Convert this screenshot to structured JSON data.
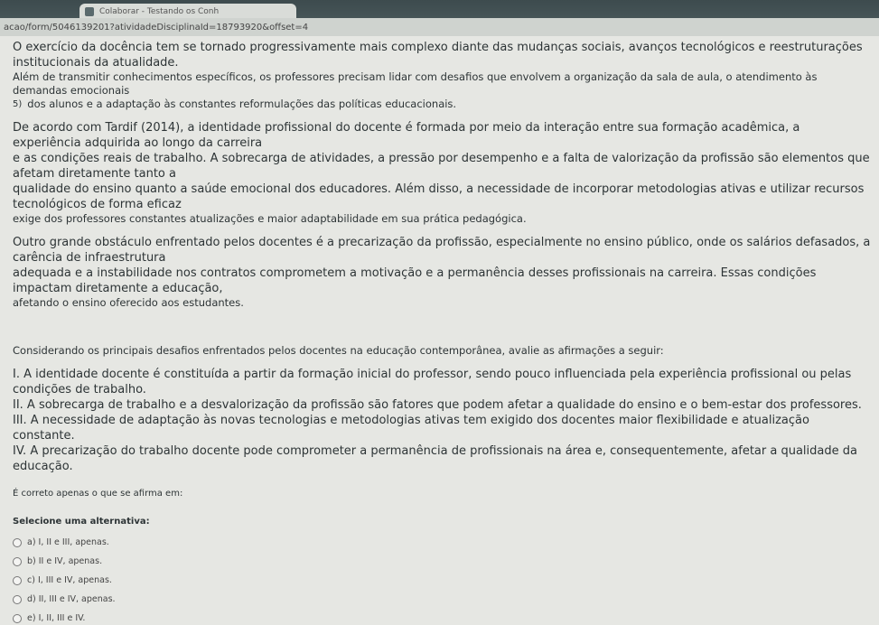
{
  "browser": {
    "tab_title": "Colaborar - Testando os Conh",
    "address": "acao/form/5046139201?atividadeDisciplinaId=18793920&offset=4"
  },
  "text": {
    "intro_line1": "O exercício da docência tem se tornado progressivamente mais complexo diante das mudanças sociais, avanços tecnológicos e reestruturações institucionais da atualidade.",
    "intro_line2": "Além de transmitir conhecimentos específicos, os professores precisam lidar com desafios que envolvem a organização da sala de aula, o atendimento às demandas emocionais",
    "intro_line3": "dos alunos e a adaptação às constantes reformulações das políticas educacionais.",
    "para2_line1": "De acordo com Tardif (2014), a identidade profissional do docente é formada por meio da interação entre sua formação acadêmica, a experiência adquirida ao longo da carreira",
    "para2_line2": "e as condições reais de trabalho. A sobrecarga de atividades, a pressão por desempenho e a falta de valorização da profissão são elementos que afetam diretamente tanto a",
    "para2_line3": "qualidade do ensino quanto a saúde emocional dos educadores. Além disso, a necessidade de incorporar metodologias ativas e utilizar recursos tecnológicos de forma eficaz",
    "para2_line4": "exige dos professores constantes atualizações e maior adaptabilidade em sua prática pedagógica.",
    "para3_line1": "Outro grande obstáculo enfrentado pelos docentes é a precarização da profissão, especialmente no ensino público, onde os salários defasados, a carência de infraestrutura",
    "para3_line2": "adequada e a instabilidade nos contratos comprometem a motivação e a permanência desses profissionais na carreira. Essas condições impactam diretamente a educação,",
    "para3_line3": "afetando o ensino oferecido aos estudantes.",
    "prompt": "Considerando os principais desafios enfrentados pelos docentes na educação contemporânea, avalie as afirmações a seguir:",
    "stmt1": "I. A identidade docente é constituída  a partir da formação inicial do professor, sendo pouco influenciada pela experiência profissional ou pelas condições de trabalho.",
    "stmt2": "II. A sobrecarga de trabalho e a desvalorização da profissão são fatores que podem afetar a qualidade do ensino e o bem-estar dos professores.",
    "stmt3": "III. A necessidade de adaptação às novas tecnologias e metodologias ativas tem exigido dos docentes maior flexibilidade e atualização constante.",
    "stmt4": "IV. A precarização do trabalho docente pode comprometer a permanência de profissionais na área e, consequentemente, afetar a qualidade da educação.",
    "correct": "É correto apenas o que se afirma em:",
    "select": "Selecione uma alternativa:",
    "q_number": "5)"
  },
  "options": [
    "a) I, II e III, apenas.",
    "b) II e IV, apenas.",
    "c) I, III e IV, apenas.",
    "d) II, III e IV, apenas.",
    "e) I, II, III e IV."
  ]
}
